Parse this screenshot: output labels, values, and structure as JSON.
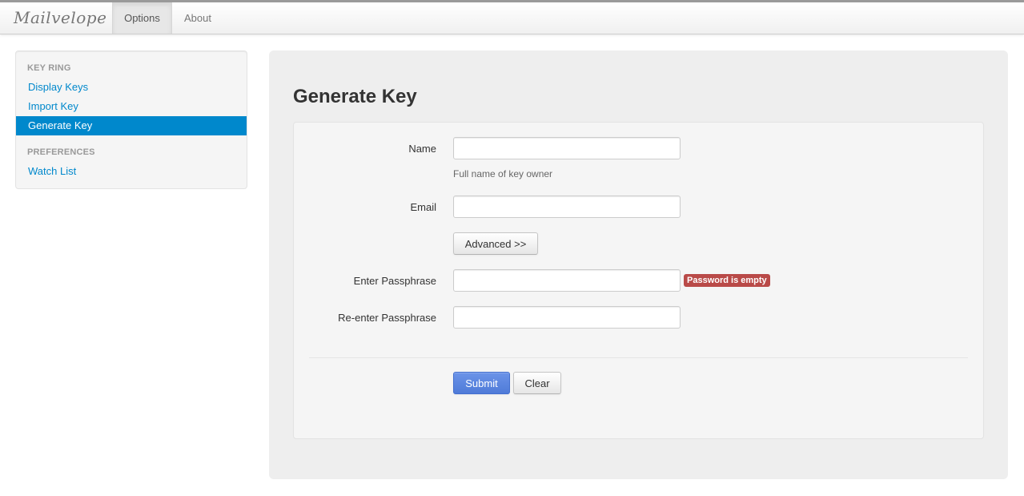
{
  "navbar": {
    "brand": "Mailvelope",
    "tabs": [
      {
        "label": "Options",
        "active": true
      },
      {
        "label": "About",
        "active": false
      }
    ]
  },
  "sidebar": {
    "sections": [
      {
        "header": "KEY RING",
        "items": [
          {
            "label": "Display Keys",
            "active": false
          },
          {
            "label": "Import Key",
            "active": false
          },
          {
            "label": "Generate Key",
            "active": true
          }
        ]
      },
      {
        "header": "PREFERENCES",
        "items": [
          {
            "label": "Watch List",
            "active": false
          }
        ]
      }
    ]
  },
  "main": {
    "title": "Generate Key",
    "form": {
      "name": {
        "label": "Name",
        "value": "",
        "help": "Full name of key owner"
      },
      "email": {
        "label": "Email",
        "value": ""
      },
      "advanced_label": "Advanced >>",
      "passphrase": {
        "label": "Enter Passphrase",
        "value": "",
        "error": "Password is empty"
      },
      "repassphrase": {
        "label": "Re-enter Passphrase",
        "value": ""
      },
      "submit_label": "Submit",
      "clear_label": "Clear"
    }
  },
  "colors": {
    "link": "#0088cc",
    "active_bg": "#0088cc",
    "primary_button": "#5b86e0",
    "error_badge": "#b94a48"
  }
}
